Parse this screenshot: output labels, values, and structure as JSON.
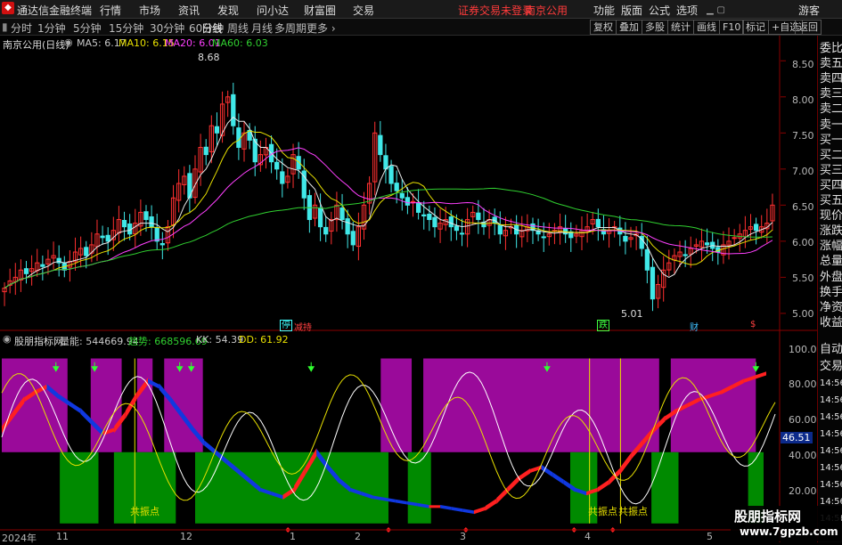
{
  "menu": {
    "app_title": "通达信金融终端",
    "items": [
      "行情",
      "市场",
      "资讯",
      "发现",
      "问小达",
      "财富圈",
      "交易"
    ],
    "warning": "证券交易未登录",
    "stock_name": "南京公用",
    "right_items": [
      "功能",
      "版面",
      "公式",
      "选项"
    ],
    "guest": "游客"
  },
  "toolbar": {
    "periods": [
      "分时",
      "1分钟",
      "5分钟",
      "15分钟",
      "30分钟",
      "60分钟",
      "日线",
      "周线",
      "月线",
      "多周期",
      "更多"
    ],
    "active": "日线",
    "right_buttons": [
      "复权",
      "叠加",
      "多股",
      "统计",
      "画线",
      "F10",
      "标记",
      "+自选",
      "返回"
    ]
  },
  "main_chart": {
    "title": "南京公用(日线)",
    "ma_labels": [
      {
        "text": "MA5: 6.17",
        "color": "#e8e8e8"
      },
      {
        "text": "MA10: 6.15",
        "color": "#e8e000"
      },
      {
        "text": "MA20: 6.01",
        "color": "#ff40ff"
      },
      {
        "text": "MA60: 6.03",
        "color": "#30d030"
      }
    ],
    "y_ticks": [
      "8.50",
      "8.00",
      "7.50",
      "7.00",
      "6.50",
      "6.00",
      "5.50",
      "5.00"
    ],
    "high_label": "8.68",
    "low_label": "5.01",
    "markers": [
      {
        "text": "停",
        "color": "#40ffff"
      },
      {
        "text": "减持",
        "color": "#ff4040"
      },
      {
        "text": "跌",
        "color": "#40ff40"
      },
      {
        "text": "财",
        "color": "#40c0ff"
      },
      {
        "text": "$",
        "color": "#ff4040"
      }
    ]
  },
  "indicator": {
    "title": "股朋指标网",
    "labels": [
      {
        "text": "量能: 544669.94",
        "color": "#ffffff"
      },
      {
        "text": "趋势: 668596.69",
        "color": "#30d030"
      },
      {
        "text": "KK: 54.39",
        "color": "#ffffff"
      },
      {
        "text": "DD: 61.92",
        "color": "#e8e000"
      }
    ],
    "y_ticks": [
      "100.0",
      "80.00",
      "60.00",
      "40.00",
      "20.00"
    ],
    "current_value": "46.51",
    "resonance_labels": [
      "共振点",
      "共振点",
      "共振点"
    ]
  },
  "x_axis": {
    "labels": [
      "2024年",
      "11",
      "12",
      "1",
      "2",
      "3",
      "4",
      "5"
    ]
  },
  "right_panel": {
    "labels": [
      "委比",
      "卖五",
      "卖四",
      "卖三",
      "卖二",
      "卖一",
      "买一",
      "买二",
      "买三",
      "买四",
      "买五",
      "现价",
      "涨跌",
      "涨幅",
      "总量",
      "外盘",
      "换手",
      "净资",
      "收益"
    ],
    "ind_labels": [
      "自动",
      "交易",
      "14:56",
      "14:56",
      "14:56",
      "14:56",
      "14:56",
      "14:56",
      "14:56",
      "14:56",
      "14:56"
    ]
  },
  "watermark": {
    "cn": "股朋指标网",
    "url": "www.7gpzb.com"
  },
  "colors": {
    "up": "#ff3030",
    "down": "#40e8e8",
    "purple_zone": "#9a0a9a",
    "green_zone": "#008a00",
    "ribbon_red": "#ff2020",
    "ribbon_blue": "#1038e0"
  },
  "chart_data": [
    {
      "type": "candlestick",
      "title": "南京公用(日线)",
      "ylim": [
        4.9,
        8.75
      ],
      "y_ticks": [
        5.0,
        5.5,
        6.0,
        6.5,
        7.0,
        7.5,
        8.0,
        8.5
      ],
      "x_labels": [
        "2024年",
        "11",
        "12",
        "1",
        "2",
        "3",
        "4",
        "5"
      ],
      "close": [
        5.35,
        5.45,
        5.5,
        5.6,
        5.55,
        5.62,
        5.7,
        5.65,
        5.75,
        5.8,
        5.7,
        5.6,
        5.72,
        5.85,
        5.9,
        5.8,
        5.95,
        6.1,
        6.05,
        6.0,
        6.15,
        6.3,
        6.2,
        6.1,
        6.25,
        6.4,
        6.3,
        6.2,
        6.0,
        5.95,
        6.2,
        6.6,
        6.8,
        6.9,
        6.6,
        7.0,
        7.3,
        7.2,
        7.6,
        7.5,
        7.9,
        8.0,
        7.6,
        7.3,
        7.5,
        7.4,
        7.1,
        7.2,
        7.3,
        7.1,
        7.0,
        6.8,
        6.9,
        7.2,
        7.0,
        6.6,
        6.3,
        6.5,
        6.2,
        6.1,
        6.3,
        6.5,
        6.3,
        6.1,
        5.95,
        6.2,
        6.5,
        6.8,
        7.5,
        7.2,
        7.0,
        6.8,
        6.7,
        6.6,
        6.5,
        6.55,
        6.4,
        6.35,
        6.3,
        6.2,
        6.25,
        6.3,
        6.2,
        6.15,
        6.1,
        6.3,
        6.4,
        6.3,
        6.2,
        6.3,
        6.25,
        6.1,
        6.15,
        6.2,
        6.1,
        6.15,
        6.2,
        6.15,
        6.1,
        6.05,
        6.1,
        6.15,
        6.2,
        6.1,
        6.05,
        6.1,
        6.15,
        6.2,
        6.3,
        6.2,
        6.1,
        6.15,
        6.2,
        6.1,
        6.0,
        6.05,
        6.1,
        5.9,
        5.6,
        5.2,
        5.4,
        5.6,
        5.7,
        5.8,
        5.85,
        5.8,
        5.9,
        5.95,
        6.0,
        5.95,
        5.9,
        5.85,
        5.95,
        6.0,
        6.05,
        6.1,
        6.15,
        6.2,
        6.15,
        6.2,
        6.25,
        6.5
      ],
      "ma_series": [
        {
          "name": "MA5",
          "color": "#e8e8e8"
        },
        {
          "name": "MA10",
          "color": "#e8e000"
        },
        {
          "name": "MA20",
          "color": "#ff40ff"
        },
        {
          "name": "MA60",
          "color": "#30d030"
        }
      ],
      "high": 8.68,
      "low": 5.01
    },
    {
      "type": "area",
      "title": "股朋指标网",
      "ylim": [
        10,
        105
      ],
      "y_ticks": [
        20,
        40,
        60,
        80,
        100
      ],
      "zones": [
        {
          "kind": "purple",
          "from": 0.0,
          "to": 0.085
        },
        {
          "kind": "purple",
          "from": 0.115,
          "to": 0.155
        },
        {
          "kind": "purple",
          "from": 0.175,
          "to": 0.195
        },
        {
          "kind": "purple",
          "from": 0.21,
          "to": 0.26
        },
        {
          "kind": "purple",
          "from": 0.49,
          "to": 0.53
        },
        {
          "kind": "purple",
          "from": 0.545,
          "to": 0.85
        },
        {
          "kind": "purple",
          "from": 0.865,
          "to": 0.975
        },
        {
          "kind": "green",
          "from": 0.075,
          "to": 0.125
        },
        {
          "kind": "green",
          "from": 0.145,
          "to": 0.225
        },
        {
          "kind": "green",
          "from": 0.25,
          "to": 0.5
        },
        {
          "kind": "green",
          "from": 0.525,
          "to": 0.555
        },
        {
          "kind": "green",
          "from": 0.735,
          "to": 0.77
        },
        {
          "kind": "green",
          "from": 0.84,
          "to": 0.875
        },
        {
          "kind": "green",
          "from": 0.965,
          "to": 0.985
        }
      ],
      "ribbon": [
        62,
        70,
        78,
        82,
        85,
        80,
        76,
        72,
        66,
        60,
        62,
        70,
        80,
        88,
        85,
        78,
        70,
        62,
        55,
        50,
        45,
        40,
        35,
        30,
        28,
        26,
        30,
        40,
        50,
        42,
        35,
        30,
        28,
        26,
        25,
        24,
        23,
        22,
        21,
        21,
        20,
        19,
        18,
        20,
        24,
        30,
        36,
        40,
        42,
        38,
        34,
        30,
        28,
        30,
        34,
        40,
        48,
        55,
        62,
        68,
        72,
        75,
        78,
        80,
        82,
        85,
        88,
        90,
        92
      ]
    }
  ]
}
